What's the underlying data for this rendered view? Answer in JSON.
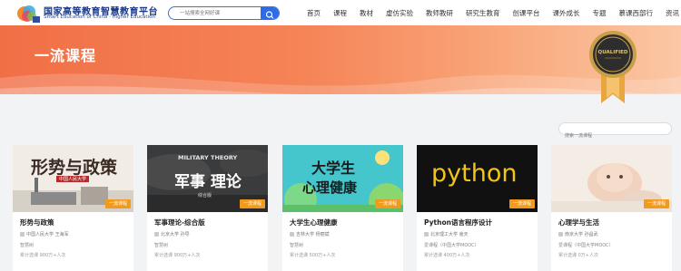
{
  "header": {
    "logo_title": "国家高等教育智慧教育平台",
    "logo_subtitle": "Smart Education of China · Higher Education",
    "search_placeholder": "一站搜索全网好课",
    "nav": [
      "首页",
      "课程",
      "教材",
      "虚仿实验",
      "教师教研",
      "研究生教育",
      "创课平台",
      "课外成长",
      "专题",
      "慕课西部行",
      "资讯"
    ]
  },
  "banner": {
    "title": "一流课程",
    "badge_text": "QUALIFIED"
  },
  "section": {
    "search_placeholder": "搜索一流课程"
  },
  "courses": [
    {
      "name": "形势与政策",
      "school": "中国人民大学 王海军",
      "platform": "智慧树",
      "stats": "累计选课 900万+人次",
      "tag": "一流课程",
      "image_text": "形势与政策",
      "image_sub": "中国人民大学"
    },
    {
      "name": "军事理论-综合版",
      "school": "北京大学 孙导",
      "platform": "智慧树",
      "stats": "累计选课 900万+人次",
      "tag": "一流课程",
      "image_en": "MILITARY THEORY",
      "image_text": "军事 理论",
      "image_sub": "综合版"
    },
    {
      "name": "大学生心理健康",
      "school": "吉林大学 杨丽斌",
      "platform": "智慧树",
      "stats": "累计选课 500万+人次",
      "tag": "一流课程",
      "image_text_1": "大学生",
      "image_text_2": "心理健康"
    },
    {
      "name": "Python语言程序设计",
      "school": "北京理工大学 嵩天",
      "platform": "爱课程（中国大学MOOC）",
      "stats": "累计选课 400万+人次",
      "tag": "一流课程",
      "image_text": "python"
    },
    {
      "name": "心理学与生活",
      "school": "南京大学 孙昌武",
      "platform": "爱课程（中国大学MOOC）",
      "stats": "累计选课 0万+人次",
      "tag": "一流课程"
    }
  ],
  "colors": {
    "brand_blue": "#2f6be6",
    "banner_orange": "#f16f46",
    "tag_orange": "#f19a1e"
  }
}
